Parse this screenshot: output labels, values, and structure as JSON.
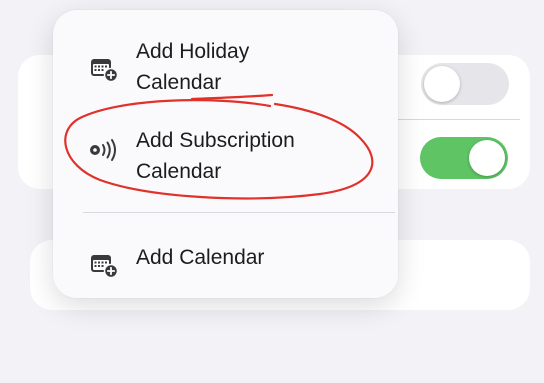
{
  "menu": {
    "items": [
      {
        "label": "Add Holiday\nCalendar",
        "icon": "calendar-plus-icon"
      },
      {
        "label": "Add Subscription\nCalendar",
        "icon": "broadcast-icon"
      },
      {
        "label": "Add Calendar",
        "icon": "calendar-plus-icon"
      }
    ]
  },
  "toggles": [
    {
      "state": "off",
      "color": "#e6e6ea"
    },
    {
      "state": "on",
      "color": "#5ec464"
    }
  ],
  "colors": {
    "background": "#f2f2f7",
    "annotation": "#e0312b",
    "toggle_on": "#5ec464"
  }
}
